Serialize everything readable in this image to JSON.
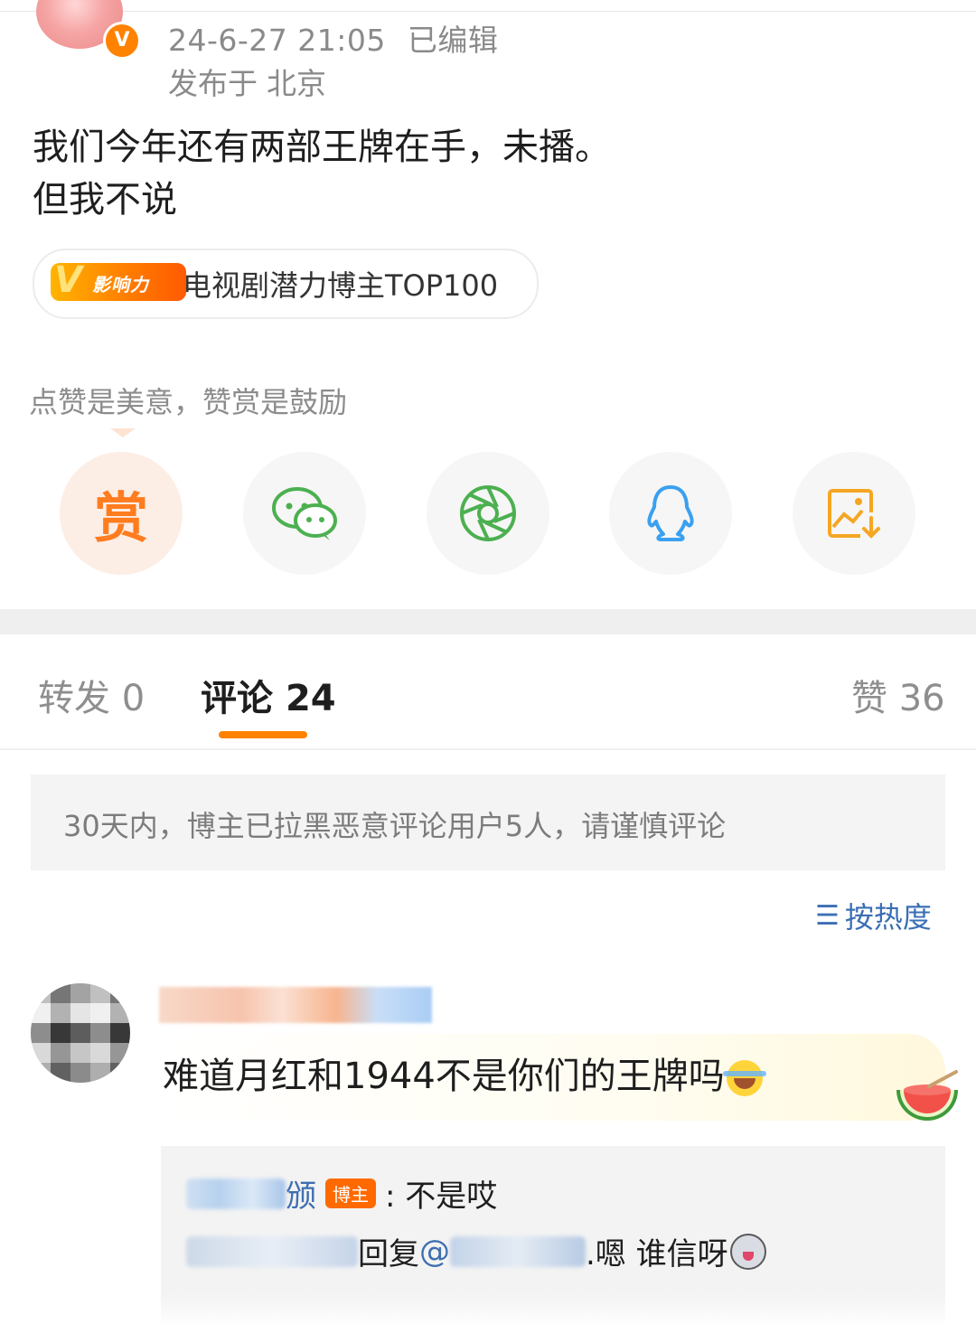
{
  "post": {
    "timestamp": "24-6-27 21:05",
    "edited_label": "已编辑",
    "location_prefix": "发布于",
    "location": "北京",
    "verified_badge": "V",
    "text_line1": "我们今年还有两部王牌在手，未播。",
    "text_line2": "但我不说",
    "influence": {
      "logo_v": "V",
      "logo_text": "影响力",
      "label": "电视剧潜力博主TOP100"
    }
  },
  "share": {
    "hint": "点赞是美意，赞赏是鼓励",
    "reward_label": "赏",
    "items": [
      "wechat-icon",
      "moments-icon",
      "qq-icon",
      "save-image-icon"
    ]
  },
  "tabs": {
    "repost_label": "转发",
    "repost_count": "0",
    "comment_label": "评论",
    "comment_count": "24",
    "like_label": "赞",
    "like_count": "36"
  },
  "notice": "30天内，博主已拉黑恶意评论用户5人，请谨慎评论",
  "sort": {
    "label": "按热度"
  },
  "comment": {
    "text": "难道月红和1944不是你们的王牌吗",
    "replies": [
      {
        "name_tail": "颁",
        "author_tag": "博主",
        "text": ": 不是哎"
      },
      {
        "reply_word": "回复",
        "mention_prefix": "@",
        "text": ".嗯 谁信呀"
      }
    ]
  },
  "colors": {
    "accent": "#ff8200",
    "link": "#3b6fb4",
    "wechat": "#4cb050",
    "qq": "#3aa0f0",
    "save": "#f5a623"
  }
}
